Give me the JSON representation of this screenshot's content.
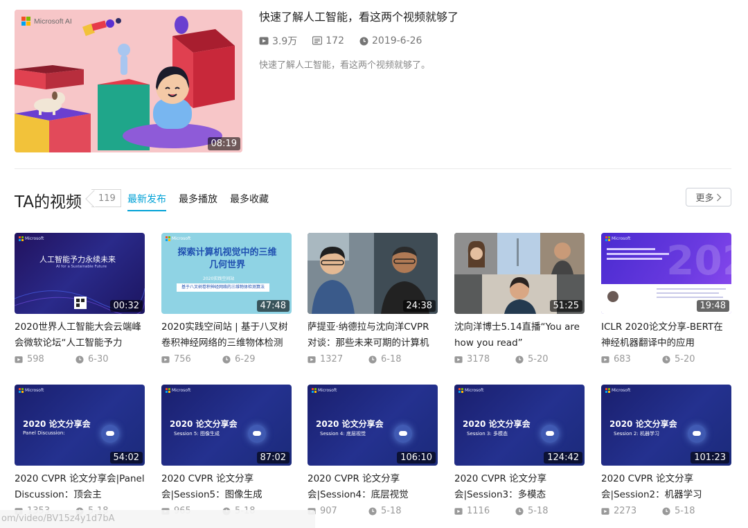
{
  "featured": {
    "logo_text": "Microsoft AI",
    "title": "快速了解人工智能，看这两个视频就够了",
    "plays": "3.9万",
    "danmaku": "172",
    "date": "2019-6-26",
    "description": "快速了解人工智能，看这两个视频就够了。",
    "duration": "08:19"
  },
  "section": {
    "title": "TA的视频",
    "count": "119",
    "tabs": [
      "最新发布",
      "最多播放",
      "最多收藏"
    ],
    "active_tab": "最新发布",
    "more_label": "更多"
  },
  "videos": [
    {
      "title": "2020世界人工智能大会云端峰会微软论坛“人工智能予力",
      "duration": "00:32",
      "plays": "598",
      "date": "6-30",
      "thumb_text": "人工智能予力永续未来",
      "thumb_sub": "AI for a Sustainable Future"
    },
    {
      "title": "2020实践空间站 | 基于八叉树卷积神经网络的三维物体检测",
      "duration": "47:48",
      "plays": "756",
      "date": "6-29",
      "thumb_text": "探索计算机视觉中的三维几何世界",
      "thumb_sub": "2020实践空间站",
      "thumb_box": "基于八叉树卷积神经网络的三维物体检测算法"
    },
    {
      "title": "萨提亚·纳德拉与沈向洋CVPR对谈：那些未来可期的计算机",
      "duration": "24:38",
      "plays": "1327",
      "date": "6-18"
    },
    {
      "title": "沈向洋博士5.14直播“You are how you read”",
      "duration": "51:25",
      "plays": "3178",
      "date": "5-20"
    },
    {
      "title": "ICLR 2020论文分享-BERT在神经机器翻译中的应用",
      "duration": "19:48",
      "plays": "683",
      "date": "5-20",
      "thumb_text": "202"
    },
    {
      "title": "2020 CVPR 论文分享会|Panel Discussion：顶会主",
      "duration": "54:02",
      "plays": "1353",
      "date": "5-18",
      "thumb_text": "2020 论文分享会",
      "thumb_sub": "Panel Discussion:"
    },
    {
      "title": "2020 CVPR 论文分享会|Session5：图像生成",
      "duration": "87:02",
      "plays": "965",
      "date": "5-18",
      "thumb_text": "2020 论文分享会",
      "thumb_sub": "Session 5: 图像生成"
    },
    {
      "title": "2020 CVPR 论文分享会|Session4：底层视觉",
      "duration": "106:10",
      "plays": "907",
      "date": "5-18",
      "thumb_text": "2020 论文分享会",
      "thumb_sub": "Session 4: 底层视觉"
    },
    {
      "title": "2020 CVPR 论文分享会|Session3：多模态",
      "duration": "124:42",
      "plays": "1116",
      "date": "5-18",
      "thumb_text": "2020 论文分享会",
      "thumb_sub": "Session 3: 多模态"
    },
    {
      "title": "2020 CVPR 论文分享会|Session2：机器学习",
      "duration": "101:23",
      "plays": "2273",
      "date": "5-18",
      "thumb_text": "2020 论文分享会",
      "thumb_sub": "Session 2: 机器学习"
    }
  ],
  "status_url": "om/video/BV15z4y1d7bA",
  "colors": {
    "accent": "#00a1d6",
    "text": "#212121",
    "meta": "#999999"
  }
}
